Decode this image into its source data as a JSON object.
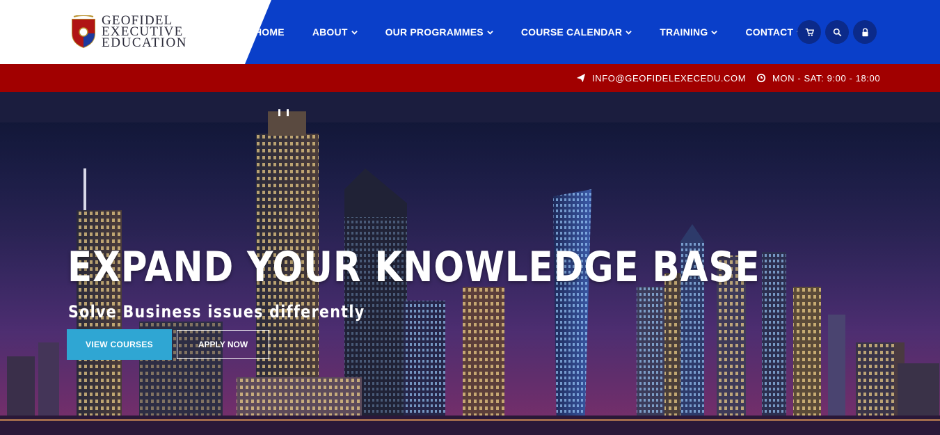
{
  "brand": {
    "logo_lines": [
      "GEOFIDEL",
      "EXECUTIVE",
      "EDUCATION"
    ]
  },
  "nav": {
    "home": "HOME",
    "about": "ABOUT",
    "programmes": "OUR PROGRAMMES",
    "calendar": "COURSE CALENDAR",
    "training": "TRAINING",
    "contact": "CONTACT"
  },
  "icons": {
    "cart": "cart-icon",
    "search": "search-icon",
    "lock": "lock-icon"
  },
  "topbar": {
    "email": "INFO@GEOFIDELEXECEDU.COM",
    "hours": "MON - SAT: 9:00 - 18:00"
  },
  "hero": {
    "title": "EXPAND YOUR KNOWLEDGE BASE",
    "subtitle": "Solve Business issues differently",
    "primary_button": "VIEW COURSES",
    "secondary_button": "APPLY NOW"
  },
  "colors": {
    "header_blue": "#0a3fc9",
    "topbar_red": "#a10000",
    "button_blue": "#2fa6d3"
  }
}
